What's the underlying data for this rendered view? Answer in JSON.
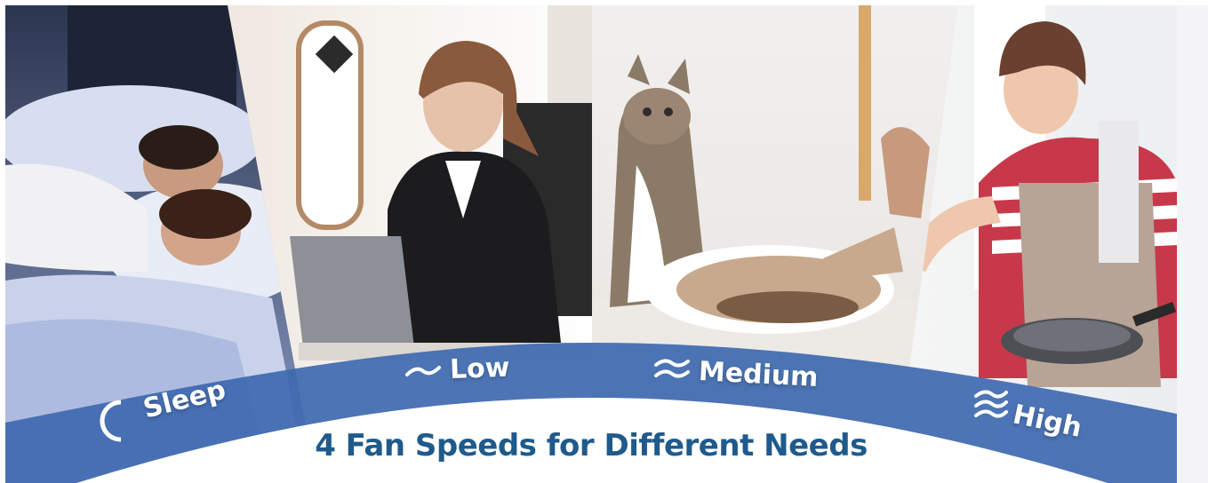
{
  "colors": {
    "band": "#3f6bb0",
    "headline": "#1f5a8c",
    "label": "#ffffff"
  },
  "modes": [
    {
      "label": "Sleep",
      "icon": "moon-icon"
    },
    {
      "label": "Low",
      "icon": "wave-1-icon"
    },
    {
      "label": "Medium",
      "icon": "wave-2-icon"
    },
    {
      "label": "High",
      "icon": "wave-3-icon"
    }
  ],
  "headline": "4 Fan Speeds for Different Needs"
}
